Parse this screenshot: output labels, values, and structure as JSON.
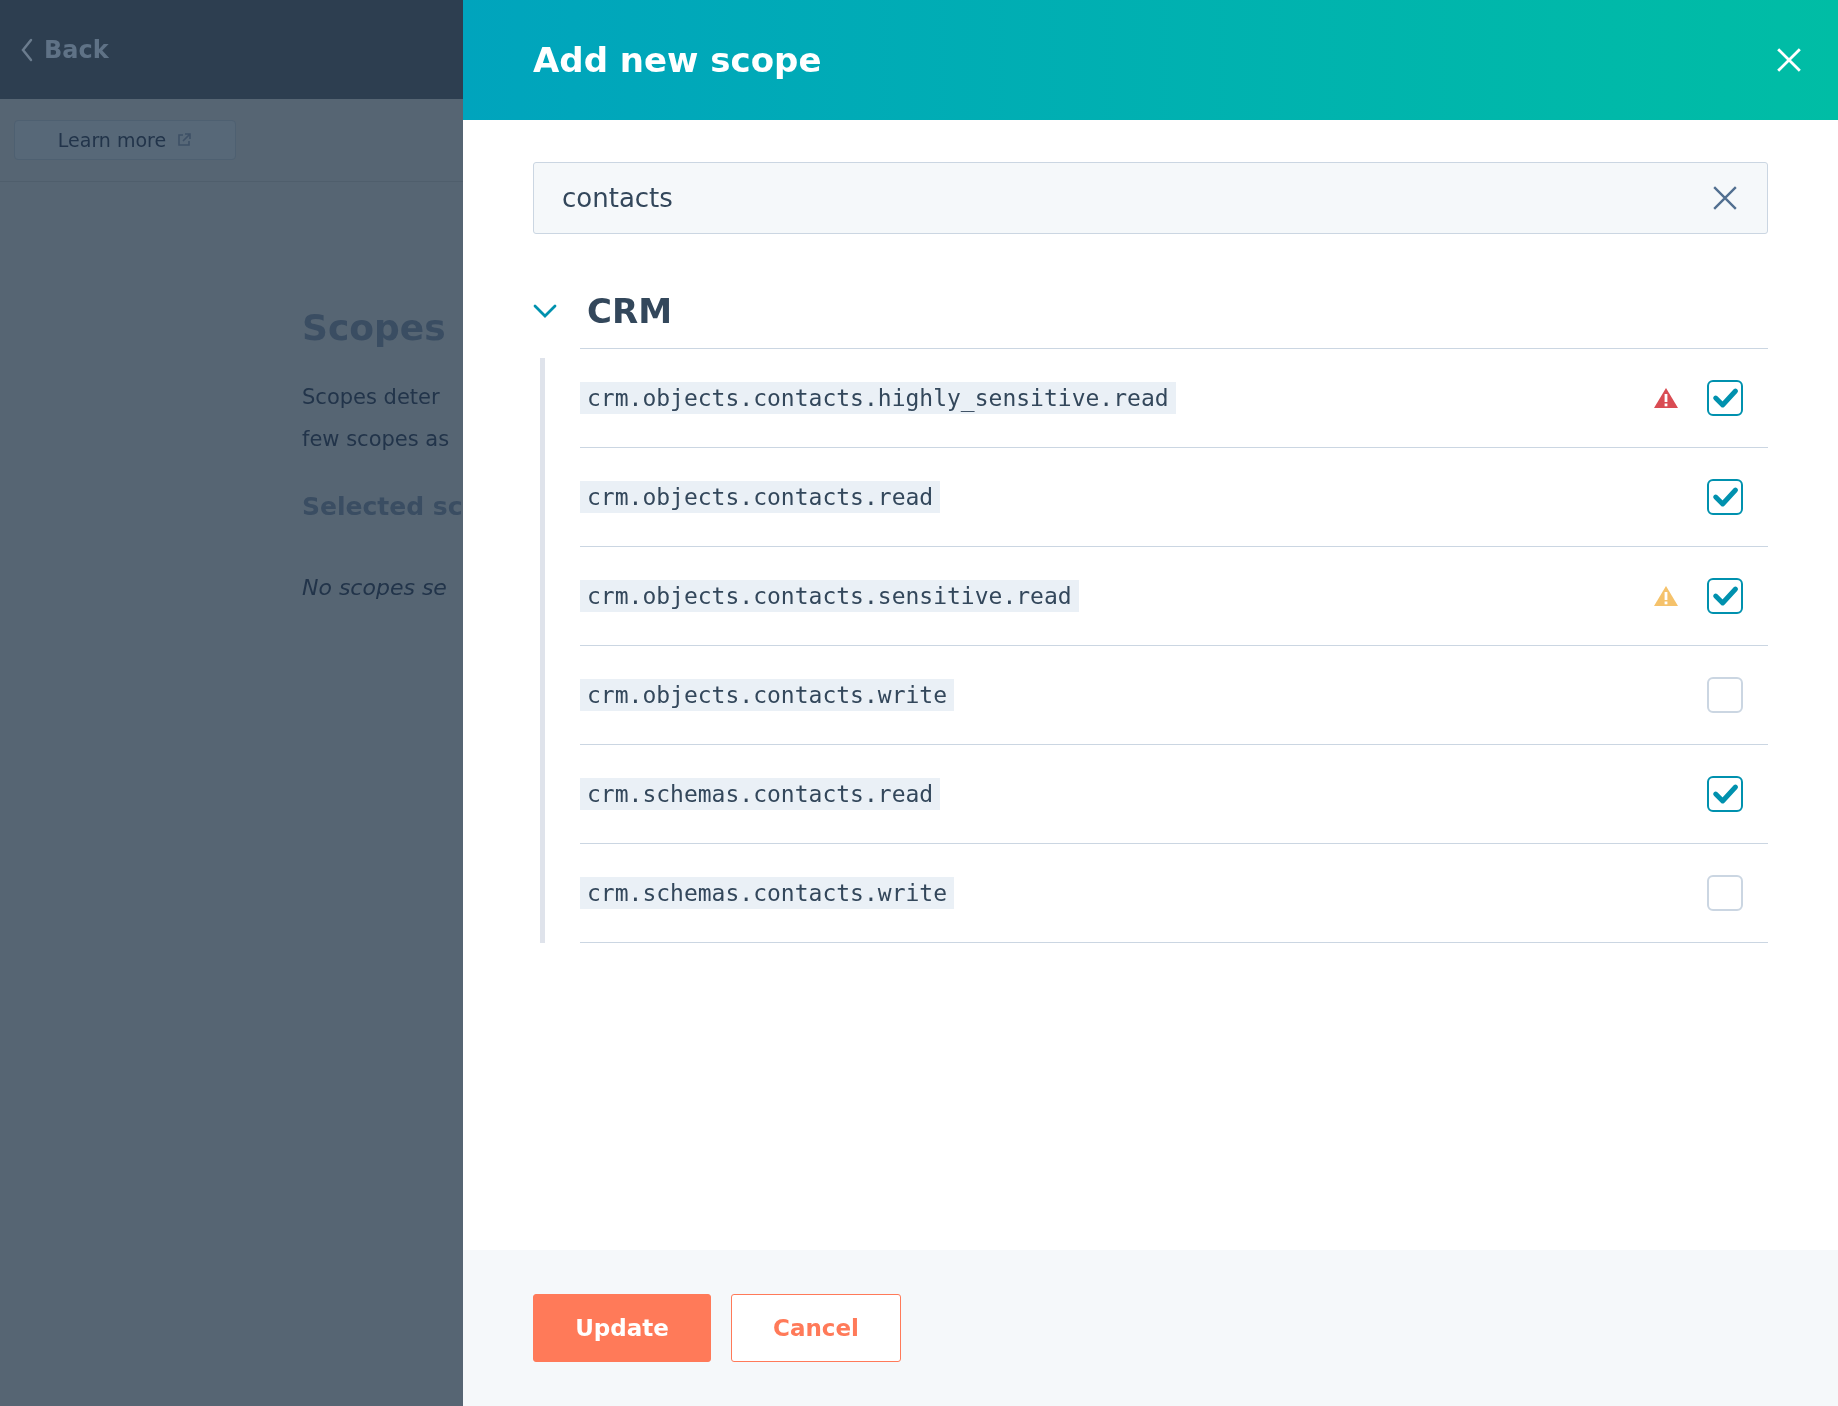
{
  "background_page": {
    "back_link": "Back",
    "learn_more_button": "Learn more",
    "heading": "Scopes",
    "description_lines": [
      "Scopes deter",
      "few scopes as"
    ],
    "subheading": "Selected sc",
    "empty_note": "No scopes se"
  },
  "dialog": {
    "title": "Add new scope",
    "search": {
      "value": "contacts"
    },
    "group": {
      "title": "CRM",
      "expanded": true,
      "scopes": [
        {
          "name": "crm.objects.contacts.highly_sensitive.read",
          "warning": {
            "color": "#d94c53"
          },
          "checked": true
        },
        {
          "name": "crm.objects.contacts.read",
          "checked": true
        },
        {
          "name": "crm.objects.contacts.sensitive.read",
          "warning": {
            "color": "#f5c26b"
          },
          "checked": true
        },
        {
          "name": "crm.objects.contacts.write",
          "checked": false
        },
        {
          "name": "crm.schemas.contacts.read",
          "checked": true
        },
        {
          "name": "crm.schemas.contacts.write",
          "checked": false
        }
      ]
    },
    "buttons": [
      {
        "label": "Update",
        "kind": "primary"
      },
      {
        "label": "Cancel",
        "kind": "secondary"
      }
    ]
  }
}
